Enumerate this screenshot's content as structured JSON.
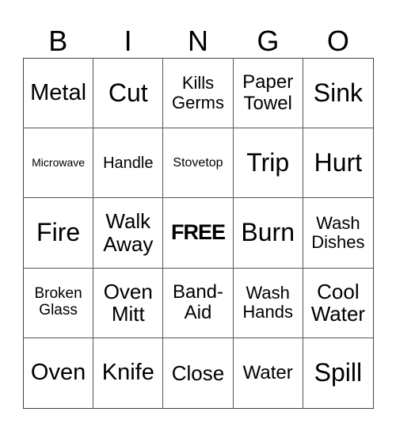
{
  "header": [
    "B",
    "I",
    "N",
    "G",
    "O"
  ],
  "cells": [
    {
      "text": "Metal",
      "size": "s29"
    },
    {
      "text": "Cut",
      "size": "s32"
    },
    {
      "text": "Kills Germs",
      "size": "s22"
    },
    {
      "text": "Paper Towel",
      "size": "s24"
    },
    {
      "text": "Sink",
      "size": "s32"
    },
    {
      "text": "Microwave",
      "size": "s14"
    },
    {
      "text": "Handle",
      "size": "s20"
    },
    {
      "text": "Stovetop",
      "size": "s16"
    },
    {
      "text": "Trip",
      "size": "s32"
    },
    {
      "text": "Hurt",
      "size": "s32"
    },
    {
      "text": "Fire",
      "size": "s32"
    },
    {
      "text": "Walk Away",
      "size": "s26"
    },
    {
      "text": "FREE",
      "size": "free"
    },
    {
      "text": "Burn",
      "size": "s32"
    },
    {
      "text": "Wash Dishes",
      "size": "s22"
    },
    {
      "text": "Broken Glass",
      "size": "s19"
    },
    {
      "text": "Oven Mitt",
      "size": "s26"
    },
    {
      "text": "Band-Aid",
      "size": "s24"
    },
    {
      "text": "Wash Hands",
      "size": "s22"
    },
    {
      "text": "Cool Water",
      "size": "s26"
    },
    {
      "text": "Oven",
      "size": "s29"
    },
    {
      "text": "Knife",
      "size": "s29"
    },
    {
      "text": "Close",
      "size": "s26"
    },
    {
      "text": "Water",
      "size": "s24"
    },
    {
      "text": "Spill",
      "size": "s32"
    }
  ]
}
